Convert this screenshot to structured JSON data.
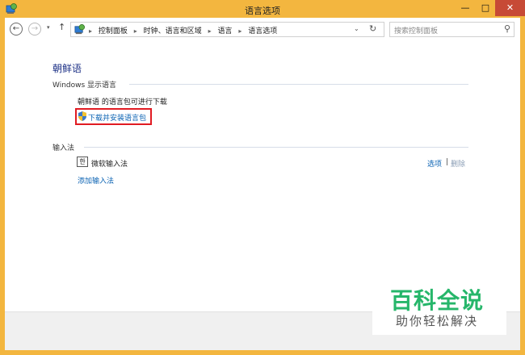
{
  "window": {
    "title": "语言选项",
    "minimize_glyph": "—",
    "maximize_glyph": "□",
    "close_glyph": "✕"
  },
  "navbar": {
    "back_glyph": "←",
    "forward_glyph": "→",
    "recent_glyph": "▾",
    "up_glyph": "↑",
    "breadcrumb": [
      "控制面板",
      "时钟、语言和区域",
      "语言",
      "语言选项"
    ],
    "breadcrumb_separator": "▸",
    "dropdown_glyph": "⌄",
    "refresh_glyph": "↻",
    "search_placeholder": "搜索控制面板",
    "search_glyph": "⚲"
  },
  "main": {
    "language_name": "朝鲜语",
    "display_language": {
      "heading": "Windows 显示语言",
      "status": "朝鲜语 的语言包可进行下载",
      "download_link": "下载并安装语言包"
    },
    "input_method": {
      "heading": "输入法",
      "ime_icon_text": "한",
      "ime_name": "微软输入法",
      "options_link": "选项",
      "divider": "|",
      "delete_link": "删除",
      "add_link": "添加输入法"
    }
  },
  "watermark": {
    "title": "百科全说",
    "subtitle": "助你轻松解决"
  },
  "colors": {
    "frame": "#f3b63f",
    "link": "#0a62b3",
    "title": "#1e3287",
    "highlight_box": "#e11b22",
    "watermark_green": "#26b66a"
  }
}
